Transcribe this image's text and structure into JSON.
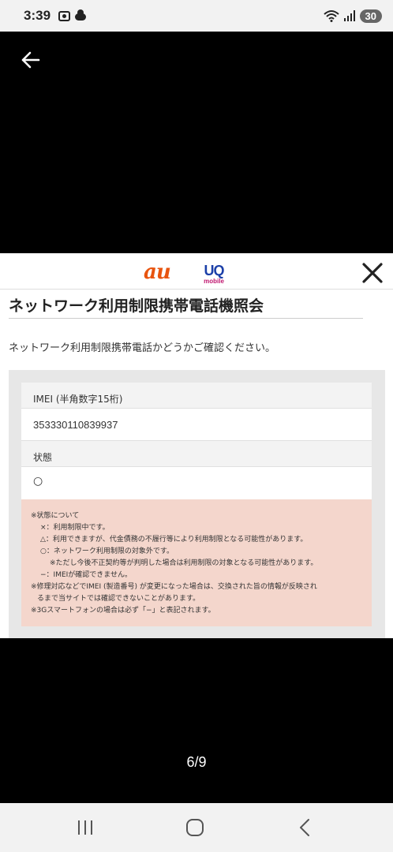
{
  "status_bar": {
    "time": "3:39",
    "battery": "30"
  },
  "viewer": {
    "page_counter": "6/9"
  },
  "header": {
    "au_logo": "au",
    "uq_logo": "UQ",
    "uq_sub": "mobile"
  },
  "page": {
    "title": "ネットワーク利用制限携帯電話機照会",
    "intro": "ネットワーク利用制限携帯電話かどうかご確認ください。"
  },
  "form": {
    "imei_label": "IMEI (半角数字15桁)",
    "imei_value": "353330110839937",
    "status_label": "状態",
    "status_value": "○"
  },
  "notes": {
    "heading": "※状態について",
    "x_line": "×：利用制限中です。",
    "triangle_line": "△：利用できますが、代金債務の不履行等により利用制限となる可能性があります。",
    "circle_line": "○：ネットワーク利用制限の対象外です。",
    "circle_sub": "※ただし今後不正契約等が判明した場合は利用制限の対象となる可能性があります。",
    "dash_line": "−：IMEIが確認できません。",
    "repair_line_1": "※修理対応などでIMEI (製造番号) が変更になった場合は、交換された旨の情報が反映され",
    "repair_line_2": "るまで当サイトでは確認できないことがあります。",
    "three_g_line": "※3Gスマートフォンの場合は必ず「−」と表記されます。"
  }
}
